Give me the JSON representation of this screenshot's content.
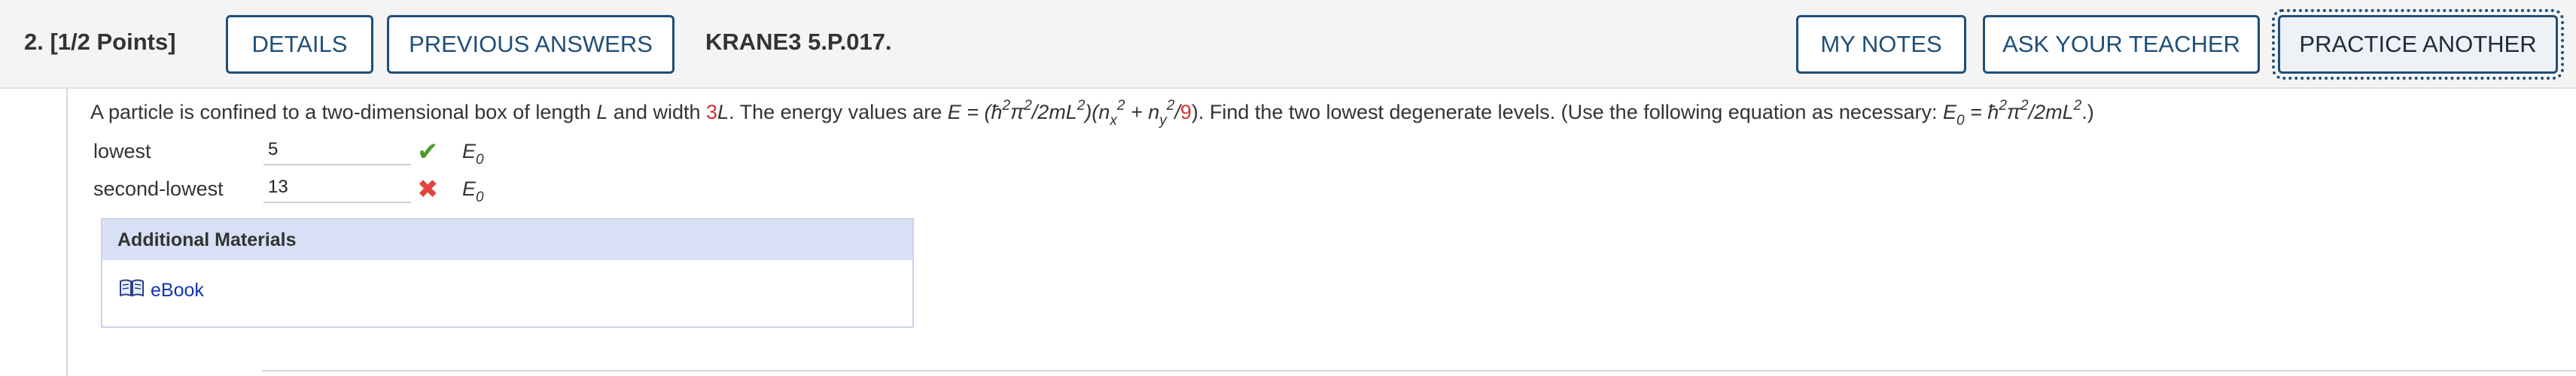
{
  "header": {
    "question_label": "2.  [1/2 Points]",
    "details_label": "DETAILS",
    "previous_answers_label": "PREVIOUS ANSWERS",
    "assignment_code": "KRANE3 5.P.017.",
    "my_notes_label": "MY NOTES",
    "ask_teacher_label": "ASK YOUR TEACHER",
    "practice_another_label": "PRACTICE ANOTHER"
  },
  "question": {
    "text_1": "A particle is confined to a two-dimensional box of length ",
    "var_L1": "L",
    "text_2": " and width ",
    "width_coeff": "3",
    "var_L2": "L",
    "text_3": ". The energy values are ",
    "formula_E_prefix": "E = (ħ",
    "formula_mid": "/2mL",
    "formula_after_L2": ")(n",
    "sub_x": "x",
    "plus_n": " + n",
    "sub_y": "y",
    "over": "/",
    "denominator": "9",
    "close_paren": ").",
    "text_4": "  Find the two lowest degenerate levels. (Use the following equation as necessary: ",
    "E0_symbol": "E",
    "E0_sub": "0",
    "E0_def_prefix": " = ħ",
    "E0_def_mid": "/2mL",
    "text_end": ".)",
    "exp_2": "2",
    "pi": "π"
  },
  "answers": [
    {
      "label": "lowest",
      "value": "5",
      "status": "correct",
      "unit": "E",
      "unit_sub": "0"
    },
    {
      "label": "second-lowest",
      "value": "13",
      "status": "incorrect",
      "unit": "E",
      "unit_sub": "0"
    }
  ],
  "marks": {
    "correct": "✔",
    "incorrect": "✖"
  },
  "additional": {
    "title": "Additional Materials",
    "ebook_label": "eBook",
    "ebook_icon": "book-icon"
  },
  "colors": {
    "brand": "#1f4e79",
    "correct": "#4e9a2a",
    "incorrect": "#e0453f",
    "highlight_red": "#d0342c",
    "panel_header": "#d7e0f5"
  }
}
